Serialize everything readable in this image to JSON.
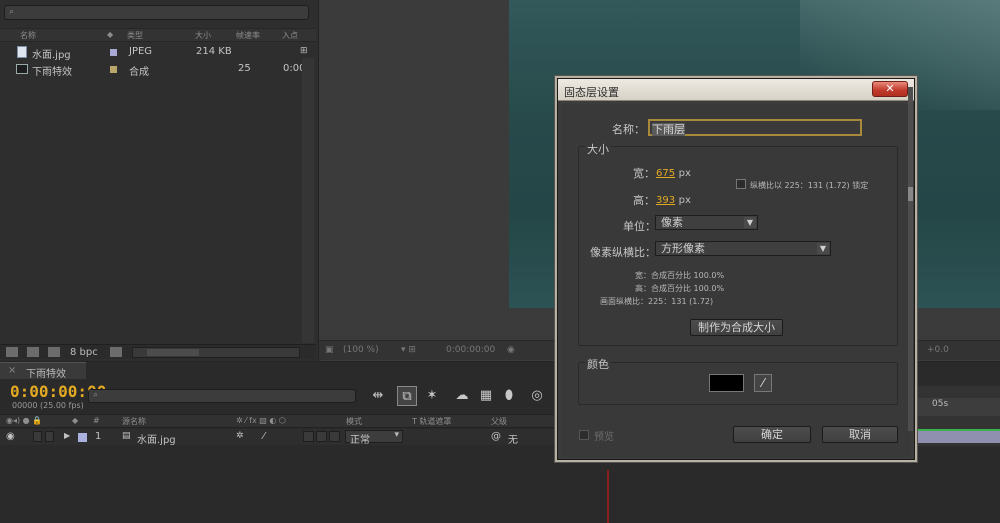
{
  "project": {
    "search_glyph": "⌕",
    "columns": [
      "名称",
      "类型",
      "大小",
      "帧速率",
      "入点"
    ],
    "items": [
      {
        "name": "水面.jpg",
        "type": "JPEG",
        "size": "214 KB",
        "fps": "",
        "in": "",
        "swatch": "#a9a9d6"
      },
      {
        "name": "下雨特效",
        "type": "合成",
        "size": "",
        "fps": "25",
        "in": "0:00",
        "swatch": "#b8a768"
      }
    ],
    "bpc": "8 bpc"
  },
  "viewer": {
    "zoom": "(100 %)",
    "timecode": "0:00:00:00",
    "exposure": "+0.0"
  },
  "timeline": {
    "tab": "下雨特效",
    "time": "0:00:00:00",
    "fps": "00000 (25.00 fps)",
    "columns": {
      "index": "#",
      "source": "源名称",
      "mode": "模式",
      "track": "T  轨道遮罩",
      "parent": "父级"
    },
    "layer": {
      "num": "1",
      "name": "水面.jpg",
      "mode": "正常",
      "parent": "无"
    },
    "ruler_label": "05s"
  },
  "dialog": {
    "title": "固态层设置",
    "close": "✕",
    "name_label": "名称：",
    "name_value": "下雨层",
    "size_group": "大小",
    "width_label": "宽：",
    "width_value": "675",
    "height_label": "高：",
    "height_value": "393",
    "px": "px",
    "lock_ratio": "纵横比以 225：131 (1.72) 锁定",
    "units_label": "单位：",
    "units_value": "像素",
    "pixel_aspect_label": "像素纵横比：",
    "pixel_aspect_value": "方形像素",
    "info_width": "宽：合成百分比 100.0%",
    "info_height": "高：合成百分比 100.0%",
    "info_frame": "画面纵横比：225：131 (1.72)",
    "make_comp_size": "制作为合成大小",
    "color_group": "颜色",
    "preview": "预览",
    "ok": "确定",
    "cancel": "取消"
  },
  "colors": {
    "accent": "#e3a922",
    "solid_color": "#000000"
  }
}
